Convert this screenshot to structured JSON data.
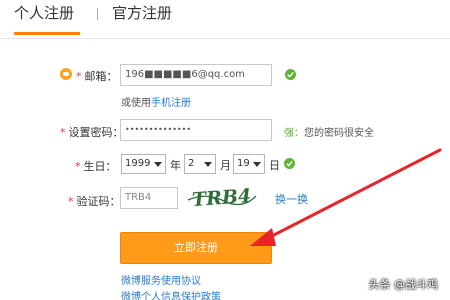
{
  "tabs": {
    "active": "个人注册",
    "other": "官方注册"
  },
  "email": {
    "label": "邮箱：",
    "value": "196■■■■■6@qq.com",
    "alt_text": "或使用",
    "alt_link": "手机注册"
  },
  "password": {
    "label": "设置密码：",
    "value": "••••••••••••••",
    "strength": "强：",
    "strength_note": "您的密码很安全"
  },
  "birthday": {
    "label": "生日：",
    "year": "1999",
    "year_unit": "年",
    "month": "2",
    "month_unit": "月",
    "day": "19",
    "day_unit": "日"
  },
  "captcha": {
    "label": "验证码：",
    "value": "TRB4",
    "image_text": "TRB4",
    "refresh": "换一换"
  },
  "submit": {
    "label": "立即注册"
  },
  "links": {
    "terms": "微博服务使用协议",
    "privacy": "微博个人信息保护政策"
  },
  "watermark": "头条 @战斗鸡",
  "colors": {
    "accent": "#ff8200",
    "button": "#ff9b18",
    "link": "#2a7ccc",
    "ok": "#5fb336",
    "required": "#e4393c",
    "arrow": "#e8242b"
  }
}
